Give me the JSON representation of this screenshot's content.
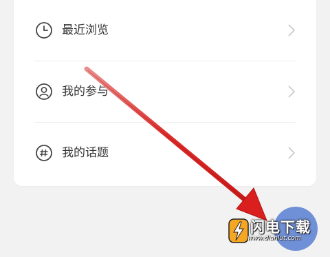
{
  "menu": {
    "items": [
      {
        "label": "最近浏览",
        "icon": "clock-icon"
      },
      {
        "label": "我的参与",
        "icon": "person-icon"
      },
      {
        "label": "我的话题",
        "icon": "hashtag-icon"
      }
    ]
  },
  "watermark": {
    "title": "闪电下载",
    "url": "www.dianlut.com"
  },
  "colors": {
    "arrow": "#d9201f",
    "fab": "#6f8fd6",
    "logo_bg": "#f5a623"
  }
}
